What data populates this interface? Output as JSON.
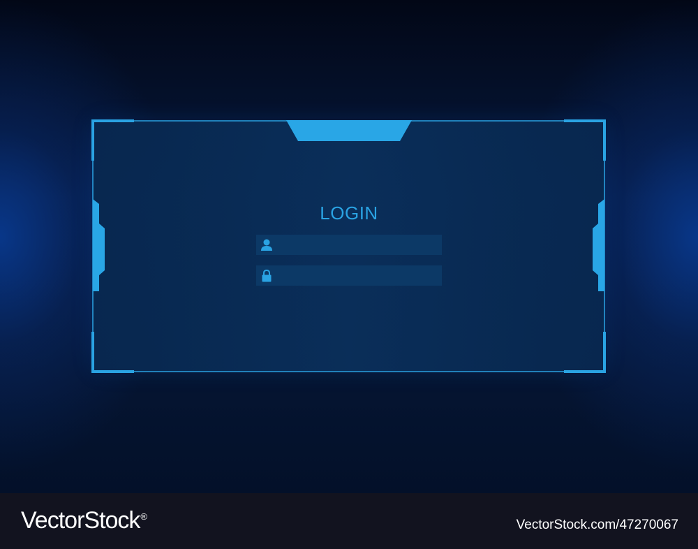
{
  "login": {
    "title": "LOGIN",
    "username_field": {
      "icon": "user-icon",
      "value": "",
      "placeholder": ""
    },
    "password_field": {
      "icon": "lock-icon",
      "value": "",
      "placeholder": ""
    }
  },
  "watermark": {
    "logo_text": "VectorStock",
    "registered_mark": "®",
    "image_id": "VectorStock.com/47270067"
  },
  "colors": {
    "background_dark": "#020716",
    "accent_cyan": "#2aa3e3",
    "panel_fill": "#0a3060",
    "field_fill": "#0c3966",
    "footer": "#12131f"
  }
}
